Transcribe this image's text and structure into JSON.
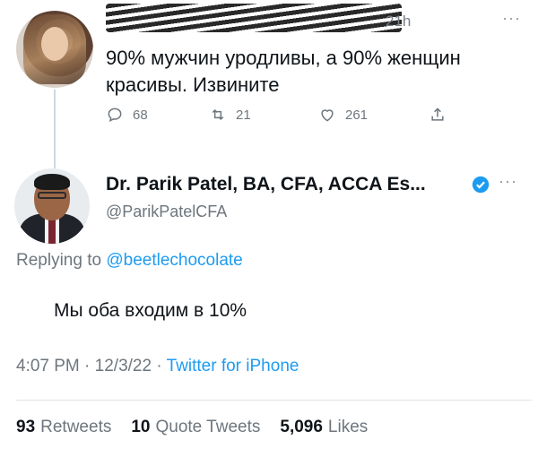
{
  "tweet1": {
    "time": "21h",
    "text": "90% мужчин уродливы, а 90% женщин красивы. Извините",
    "replies": "68",
    "retweets": "21",
    "likes": "261"
  },
  "reply": {
    "author_name": "Dr. Parik Patel, BA, CFA, ACCA Es...",
    "handle": "@ParikPatelCFA",
    "replying_prefix": "Replying to",
    "replying_mention": "@beetlechocolate",
    "text": "Мы оба входим в 10%",
    "time": "4:07 PM",
    "separator1": "·",
    "date": "12/3/22",
    "separator2": "·",
    "source": "Twitter for iPhone",
    "retweets_count": "93",
    "retweets_label": "Retweets",
    "quotes_count": "10",
    "quotes_label": "Quote Tweets",
    "likes_count": "5,096",
    "likes_label": "Likes"
  },
  "colors": {
    "accent": "#1d9bf0",
    "muted": "#6e767d",
    "text": "#0f1419"
  }
}
